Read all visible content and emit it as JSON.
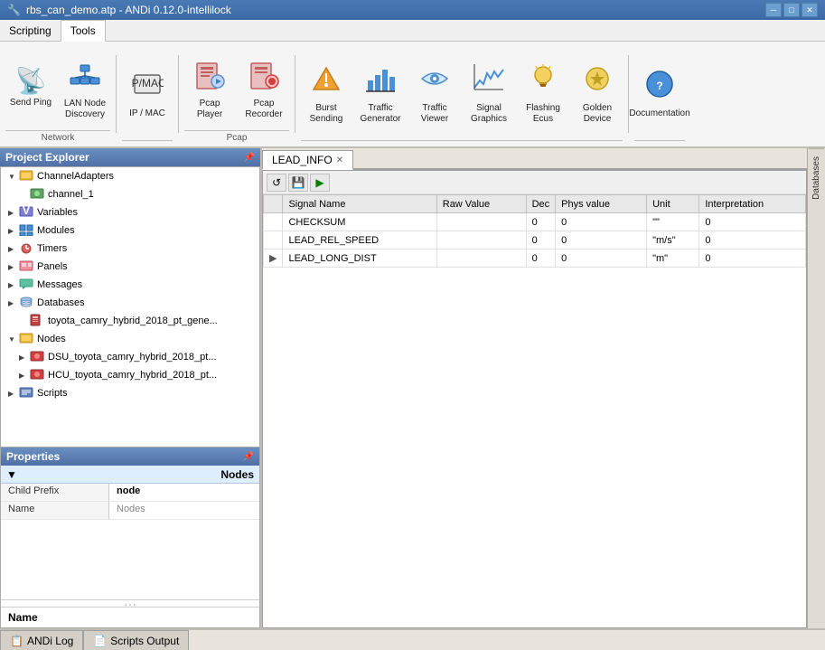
{
  "title_bar": {
    "text": "rbs_can_demo.atp - ANDi 0.12.0-intellilock",
    "minimize": "─",
    "maximize": "□",
    "close": "✕"
  },
  "menu": {
    "items": [
      "Scripting",
      "Tools"
    ]
  },
  "toolbar": {
    "groups": [
      {
        "label": "Network",
        "items": [
          {
            "id": "send-ping",
            "icon": "📡",
            "label": "Send Ping"
          },
          {
            "id": "lan-node",
            "icon": "🖧",
            "label": "LAN Node Discovery"
          }
        ]
      },
      {
        "label": "",
        "items": [
          {
            "id": "ip-mac",
            "icon": "🔗",
            "label": "IP / MAC"
          }
        ]
      },
      {
        "label": "Pcap",
        "items": [
          {
            "id": "pcap-player",
            "icon": "💾",
            "label": "Pcap Player"
          },
          {
            "id": "pcap-recorder",
            "icon": "⏺",
            "label": "Pcap Recorder"
          }
        ]
      },
      {
        "label": "",
        "items": [
          {
            "id": "burst-sending",
            "icon": "📤",
            "label": "Burst Sending"
          },
          {
            "id": "traffic-gen",
            "icon": "📊",
            "label": "Traffic Generator"
          },
          {
            "id": "traffic-viewer",
            "icon": "👁",
            "label": "Traffic Viewer"
          },
          {
            "id": "signal-graphics",
            "icon": "📈",
            "label": "Signal Graphics"
          },
          {
            "id": "flashing-ecus",
            "icon": "👷",
            "label": "Flashing Ecus"
          },
          {
            "id": "golden-device",
            "icon": "⚙",
            "label": "Golden Device"
          }
        ]
      },
      {
        "label": "",
        "items": [
          {
            "id": "documentation",
            "icon": "❓",
            "label": "Documentation"
          }
        ]
      }
    ]
  },
  "project_explorer": {
    "title": "Project Explorer",
    "tree": [
      {
        "id": "channel-adapters",
        "level": 0,
        "expanded": true,
        "icon": "📁",
        "label": "ChannelAdapters"
      },
      {
        "id": "channel-1",
        "level": 1,
        "expanded": false,
        "icon": "🔧",
        "label": "channel_1"
      },
      {
        "id": "variables",
        "level": 0,
        "expanded": false,
        "icon": "📋",
        "label": "Variables"
      },
      {
        "id": "modules",
        "level": 0,
        "expanded": false,
        "icon": "📦",
        "label": "Modules"
      },
      {
        "id": "timers",
        "level": 0,
        "expanded": false,
        "icon": "⏱",
        "label": "Timers"
      },
      {
        "id": "panels",
        "level": 0,
        "expanded": false,
        "icon": "🎨",
        "label": "Panels"
      },
      {
        "id": "messages",
        "level": 0,
        "expanded": false,
        "icon": "✉",
        "label": "Messages"
      },
      {
        "id": "databases",
        "level": 0,
        "expanded": false,
        "icon": "🗄",
        "label": "Databases"
      },
      {
        "id": "toyota-db",
        "level": 1,
        "expanded": false,
        "icon": "📄",
        "label": "toyota_camry_hybrid_2018_pt_gene..."
      },
      {
        "id": "nodes",
        "level": 0,
        "expanded": true,
        "icon": "📁",
        "label": "Nodes"
      },
      {
        "id": "dsu-node",
        "level": 1,
        "expanded": false,
        "icon": "🔴",
        "label": "DSU_toyota_camry_hybrid_2018_pt..."
      },
      {
        "id": "hcu-node",
        "level": 1,
        "expanded": false,
        "icon": "🔴",
        "label": "HCU_toyota_camry_hybrid_2018_pt..."
      },
      {
        "id": "scripts",
        "level": 0,
        "expanded": false,
        "icon": "📝",
        "label": "Scripts"
      }
    ]
  },
  "properties": {
    "title": "Properties",
    "category": "Nodes",
    "rows": [
      {
        "key": "Child Prefix",
        "value": "node",
        "bold": true
      },
      {
        "key": "Name",
        "value": "Nodes",
        "bold": false,
        "gray": true
      }
    ],
    "name_label": "Name"
  },
  "signal_tab": {
    "label": "LEAD_INFO",
    "toolbar_btns": [
      "↺",
      "💾",
      "▶"
    ],
    "columns": [
      "Signal Name",
      "Raw Value",
      "Dec",
      "Phys value",
      "Unit",
      "Interpretation"
    ],
    "rows": [
      {
        "expand": false,
        "name": "CHECKSUM",
        "raw": "",
        "dec": "0",
        "phys": "0",
        "unit": "\"\"",
        "interp": "0"
      },
      {
        "expand": false,
        "name": "LEAD_REL_SPEED",
        "raw": "",
        "dec": "0",
        "phys": "0",
        "unit": "\"m/s\"",
        "interp": "0"
      },
      {
        "expand": true,
        "name": "LEAD_LONG_DIST",
        "raw": "",
        "dec": "0",
        "phys": "0",
        "unit": "\"m\"",
        "interp": "0"
      }
    ]
  },
  "right_sidebar": {
    "label": "Databases"
  },
  "status_bar": {
    "tabs": [
      {
        "icon": "📋",
        "label": "ANDi Log"
      },
      {
        "icon": "📄",
        "label": "Scripts Output"
      }
    ]
  }
}
